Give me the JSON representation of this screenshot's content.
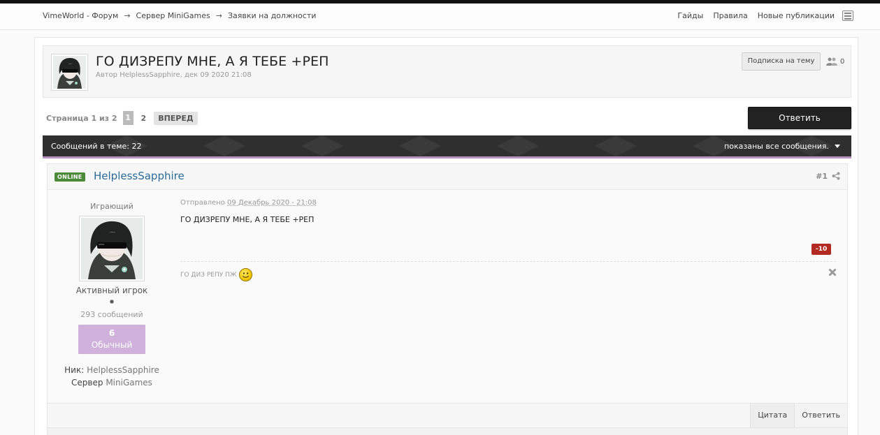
{
  "breadcrumb": {
    "items": [
      "VimeWorld - Форум",
      "Сервер MiniGames",
      "Заявки на должности"
    ],
    "separator": "→"
  },
  "topnav": {
    "items": [
      "Гайды",
      "Правила",
      "Новые публикации"
    ]
  },
  "topic": {
    "title": "ГО ДИЗРЕПУ МНЕ, А Я ТЕБЕ +РЕП",
    "meta": "Автор HelplessSapphire, дек 09 2020 21:08",
    "subscribe_label": "Подписка на тему",
    "followers": "0"
  },
  "pagination": {
    "label": "Страница 1 из 2",
    "current": "1",
    "other": "2",
    "next_label": "ВПЕРЕД"
  },
  "reply_button_label": "Ответить",
  "posts_bar": {
    "count_text": "Сообщений в теме: 22",
    "filter_text": "показаны все сообщения."
  },
  "post": {
    "status": "ONLINE",
    "author": "HelplessSapphire",
    "number": "#1",
    "group": "Играющий",
    "title": "Активный игрок",
    "post_count": "293 сообщений",
    "rep_value": "6",
    "rep_label": "Обычный",
    "nick_label": "Ник:",
    "nick_value": "HelplessSapphire",
    "server_label": "Сервер",
    "server_value": "MiniGames",
    "posted_prefix": "Отправлено",
    "posted_date": "09 Декабрь 2020 - 21:08",
    "content": "ГО ДИЗРЕПУ МНЕ, А Я ТЕБЕ +РЕП",
    "rating": "-10",
    "signature": "ГО ДИЗ РЕПУ ПЖ",
    "quote_label": "Цитата",
    "reply_label": "Ответить"
  },
  "colors": {
    "online_badge": "#4c8a3a",
    "author_link": "#2b6b98",
    "rep_box": "#cfb1dc",
    "rating_badge": "#b22a22",
    "bar_accent": "#b892c2"
  },
  "icons": [
    "menu-icon",
    "followers-icon",
    "chevron-down-icon",
    "share-icon",
    "close-icon",
    "smiley-icon"
  ]
}
